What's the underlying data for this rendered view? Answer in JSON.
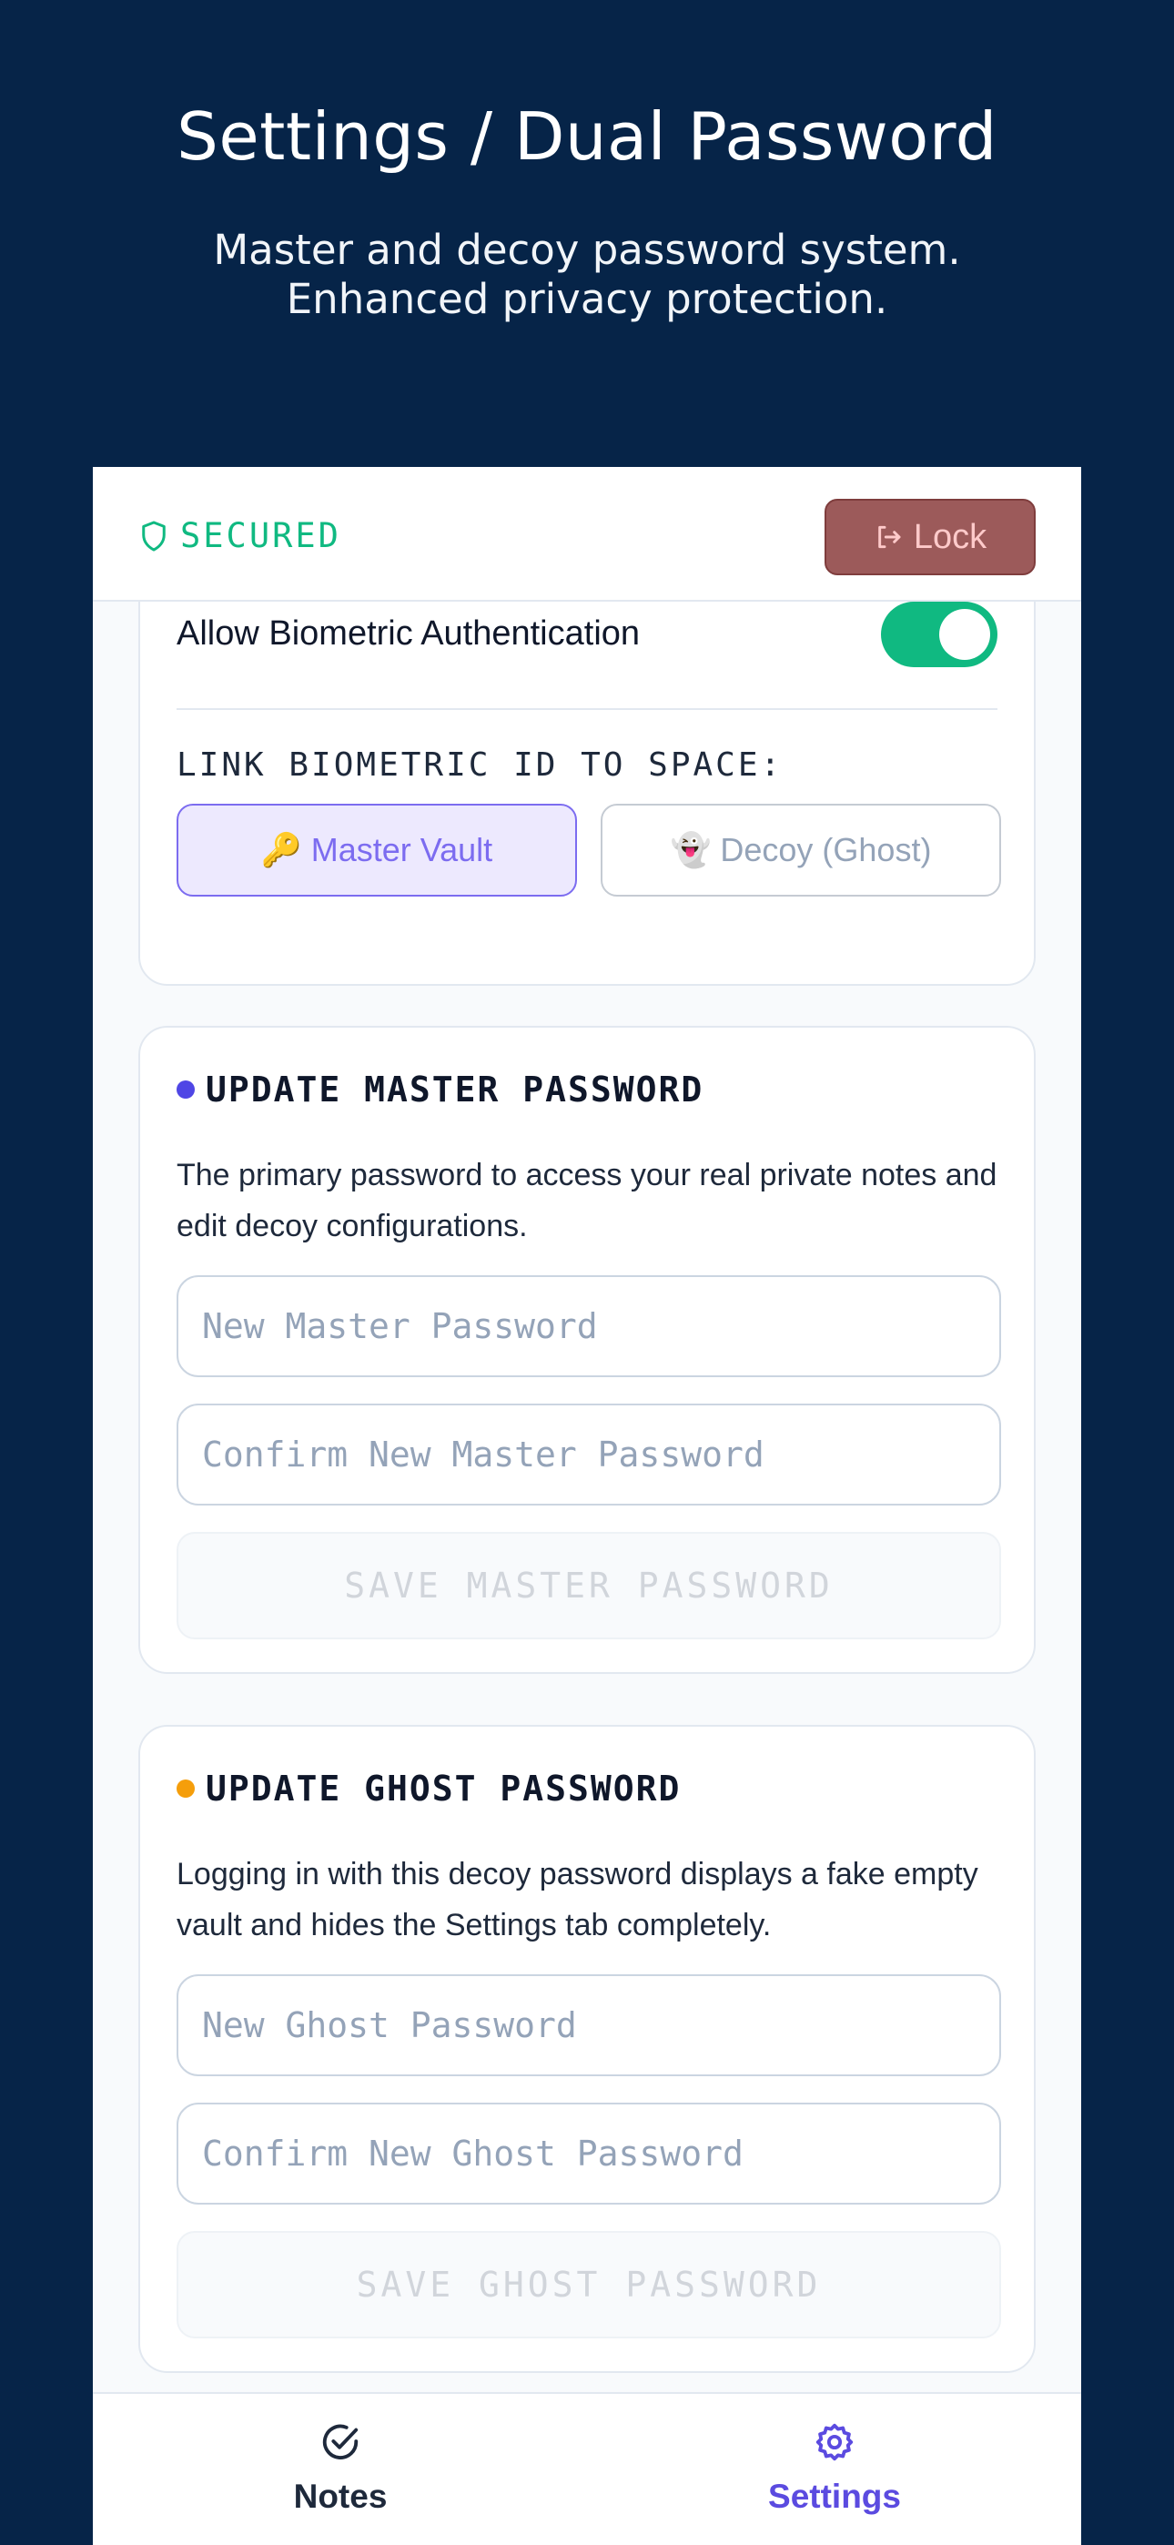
{
  "hero": {
    "title": "Settings / Dual Password",
    "subtitle_line1": "Master and decoy password system.",
    "subtitle_line2": "Enhanced privacy protection."
  },
  "topbar": {
    "status": "SECURED",
    "lock_label": "Lock"
  },
  "biometric": {
    "label": "Allow Biometric Authentication",
    "enabled": true,
    "link_label": "LINK BIOMETRIC ID TO SPACE:",
    "master_emoji": "🔑",
    "master_label": "Master Vault",
    "decoy_emoji": "👻",
    "decoy_label": "Decoy (Ghost)"
  },
  "master": {
    "heading": "UPDATE MASTER PASSWORD",
    "description": "The primary password to access your real private notes and edit decoy configurations.",
    "new_placeholder": "New Master Password",
    "confirm_placeholder": "Confirm New Master Password",
    "save_label": "SAVE MASTER PASSWORD"
  },
  "ghost": {
    "heading": "UPDATE GHOST PASSWORD",
    "description": "Logging in with this decoy password displays a fake empty vault and hides the Settings tab completely.",
    "new_placeholder": "New Ghost Password",
    "confirm_placeholder": "Confirm New Ghost Password",
    "save_label": "SAVE GHOST PASSWORD"
  },
  "nav": {
    "notes_label": "Notes",
    "settings_label": "Settings",
    "active": "settings"
  },
  "colors": {
    "background": "#062448",
    "secured": "#10b981",
    "accent": "#5b4be0",
    "master_dot": "#4f46e5",
    "ghost_dot": "#f59e0b",
    "lock_button": "#9c5a5a"
  }
}
